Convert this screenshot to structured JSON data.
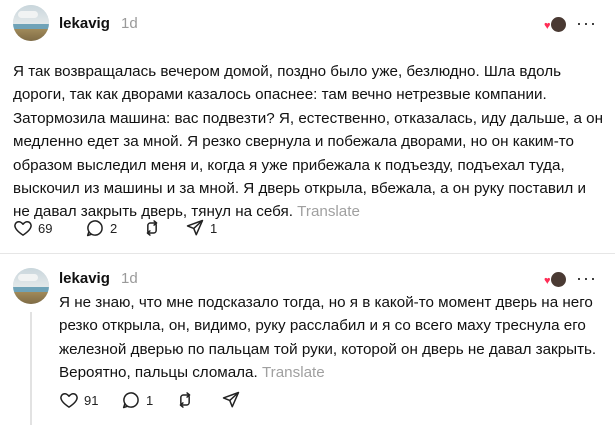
{
  "posts": [
    {
      "username": "lekavig",
      "time": "1d",
      "more": "···",
      "text": "Я так возвращалась вечером домой, поздно было уже, безлюдно. Шла вдоль дороги, так как дворами казалось опаснее: там вечно нетрезвые компании. Затормозила машина: вас подвезти? Я, естественно, отказалась, иду дальше, а он медленно едет за мной. Я резко свернула и побежала дворами, но он каким-то образом выследил меня и, когда я уже прибежала к подъезду, подъехал туда, выскочил из машины и за мной. Я дверь открыла, вбежала, а он руку поставил и не давал закрыть дверь, тянул на себя.",
      "translate": "Translate",
      "likes": "69",
      "replies": "2",
      "shares": "1"
    },
    {
      "username": "lekavig",
      "time": "1d",
      "more": "···",
      "text": "Я не знаю, что мне подсказало тогда, но я в какой-то момент дверь на него резко открыла, он, видимо, руку расслабил и я со всего маху треснула его железной дверью по пальцам той руки, которой он дверь не давал закрыть. Вероятно, пальцы сломала.",
      "translate": "Translate",
      "likes": "91",
      "replies": "1"
    }
  ],
  "icons": {
    "like": "heart-icon",
    "reply": "comment-icon",
    "repost": "repost-icon",
    "share": "send-icon"
  }
}
